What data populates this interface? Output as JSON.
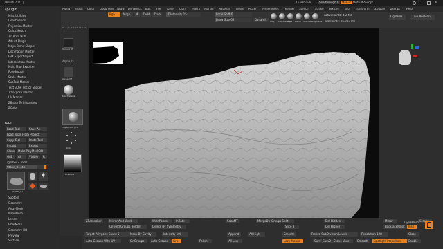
{
  "window": {
    "title": "ZBrush 2021 |",
    "quicksave": "QuickSave",
    "seethrough": "See-through 0",
    "menus_label": "Menus",
    "default_script": "DefaultZScript",
    "icons": [
      "search-icon",
      "minimize-icon",
      "maximize-icon",
      "close-icon"
    ]
  },
  "menubar": [
    "Alpha",
    "Brush",
    "Color",
    "Document",
    "Draw",
    "Dynamics",
    "Edit",
    "File",
    "Layer",
    "Light",
    "Macro",
    "Marker",
    "Material",
    "Movie",
    "Picker",
    "Preferences",
    "Render",
    "Stencil",
    "Stroke",
    "Texture",
    "Tool",
    "Transform",
    "Zplugin",
    "Zscript",
    "Help"
  ],
  "zplugin": {
    "header": "Zplugin",
    "items": [
      "Misc Utilities",
      "Deactivation",
      "Projection Master",
      "QuickSketch",
      "3D Print Hub",
      "Adjust Plugin",
      "Maya Blend Shapes",
      "Decimation Master",
      "FBX ExportImport",
      "Intersection Master",
      "Multi Map Exporter",
      "PolyGroupIt",
      "Scale Master",
      "SubTool Master",
      "Text 3D & Vector Shapes",
      "Transpose Master",
      "UV Master",
      "ZBrush To Photoshop",
      "ZColor"
    ]
  },
  "tool": {
    "header": "Tool",
    "buttons": [
      "Load Tool",
      "Save As",
      "Load Tools From Project",
      "Copy Tool",
      "Paste Tool",
      "Import",
      "Export",
      "Clone",
      "Make PolyMesh3D",
      "GoZ",
      "All",
      "Visible",
      "R"
    ],
    "lightbox_tools": "Lightbox ▸ Tools",
    "stone_label": "Stone_01. 48",
    "thumbs": [
      "Stone_01",
      "Cylinder3D",
      "PolyMesh3D",
      "SimpleBrush",
      "Stone_0"
    ],
    "sections": [
      "Subtool",
      "Geometry",
      "ArrayMesh",
      "NanoMesh",
      "Layers",
      "FiberMesh",
      "Geometry HD",
      "Preview",
      "Surface"
    ]
  },
  "top_shelf": {
    "coords": "0.32,-0.115,0.568",
    "rgb": "Rgb",
    "mrgb": "Mrgb",
    "m": "M",
    "zadd": "Zadd",
    "zsub": "Zsub",
    "z_intensity": "Z Intensity 15",
    "focal_shift": "Focal Shift 0",
    "draw_size": "Draw Size 64",
    "dynamic": "Dynamic",
    "brushes": [
      "Clay",
      "ClayBuildup",
      "Move",
      "Polish",
      "Standard",
      "ClayTubes"
    ],
    "active_points": "ActivePoints: 4.2 Mil",
    "total_points": "TotalPoints: 25.903 Mil",
    "lightbox": "LightBox",
    "live_boolean": "Live Boolean"
  },
  "left_shelf": {
    "texture_off": "Texture Off",
    "alpha_off": "Alpha Off",
    "material": "BasicMaterial",
    "brush": "ClaySphere (T1)",
    "stroke": "Dots",
    "gradient": "Gradient",
    "alpha_d": "Alpha D"
  },
  "canvas": {
    "gizmo_axes": [
      "x-axis",
      "y-axis",
      "z-axis"
    ]
  },
  "bottom": {
    "row1": [
      "ZRemesher",
      "Mirror And Weld",
      "WeldPoints",
      "Inflate",
      "ScanMT",
      "MergeDown",
      "Groups Split",
      "Del Lower",
      "Mirror",
      "Groups",
      "Crease",
      "Del Hidden"
    ],
    "row2": [
      "Unweld Groups Border",
      "Delete By Symmetry",
      "Slice 8",
      "Del Higher",
      "BackfaceMask",
      "Insp"
    ],
    "row3": [
      "Target Polygons Count 5",
      "Mask By Cavity",
      "Intensity 100",
      "Append",
      "All High",
      "Smooth",
      "Freeze SubDivision Levels",
      "Resolution 128",
      "Close"
    ],
    "row4": [
      "Auto Groups With UV",
      "Gr Groups",
      "Auto Groups",
      "Grp",
      "Polish",
      "All Low",
      "Lazy Mouse",
      "Curv1",
      "Curv2",
      "Stone Voxe",
      "Smooth",
      "Spotlight Projection",
      "Enable"
    ],
    "dynamesh": "DynaMesh",
    "pnt": "Pnt",
    "sel": "Sel"
  },
  "colors": {
    "accent": "#e8821f",
    "bg": "#2a2a2a",
    "panel": "#303030",
    "canvas": "#0c0c0c"
  }
}
